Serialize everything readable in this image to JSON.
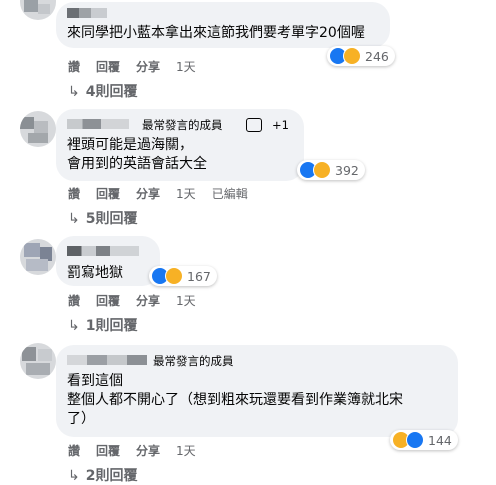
{
  "colors": {
    "bubble": "#f0f2f5",
    "like": "#1877f2",
    "haha": "#f7b125",
    "meta": "#65676b"
  },
  "comments": [
    {
      "text_lines": [
        "來同學把小藍本拿出來這節我們要考單字20個喔"
      ],
      "reaction_count": "246",
      "reaction_icons": [
        "like-icon",
        "haha-icon"
      ],
      "actions": [
        "讚",
        "回覆",
        "分享",
        "1天"
      ],
      "replies": "4則回覆"
    },
    {
      "badge": "最常發言的成員",
      "badge_extra": "+1",
      "text_lines": [
        "裡頭可能是過海關，",
        "會用到的英語會話大全"
      ],
      "reaction_count": "392",
      "reaction_icons": [
        "like-icon",
        "haha-icon"
      ],
      "actions": [
        "讚",
        "回覆",
        "分享",
        "1天",
        "已編輯"
      ],
      "replies": "5則回覆"
    },
    {
      "text_lines": [
        "罰寫地獄"
      ],
      "reaction_count": "167",
      "reaction_icons": [
        "like-icon",
        "haha-icon"
      ],
      "actions": [
        "讚",
        "回覆",
        "分享",
        "1天"
      ],
      "replies": "1則回覆"
    },
    {
      "badge": "最常發言的成員",
      "text_lines": [
        "看到這個",
        "整個人都不開心了（想到粗來玩還要看到作業簿就北宋",
        "了）"
      ],
      "reaction_count": "144",
      "reaction_icons": [
        "haha-icon",
        "like-icon"
      ],
      "actions": [
        "讚",
        "回覆",
        "分享",
        "1天"
      ],
      "replies": "2則回覆"
    }
  ]
}
